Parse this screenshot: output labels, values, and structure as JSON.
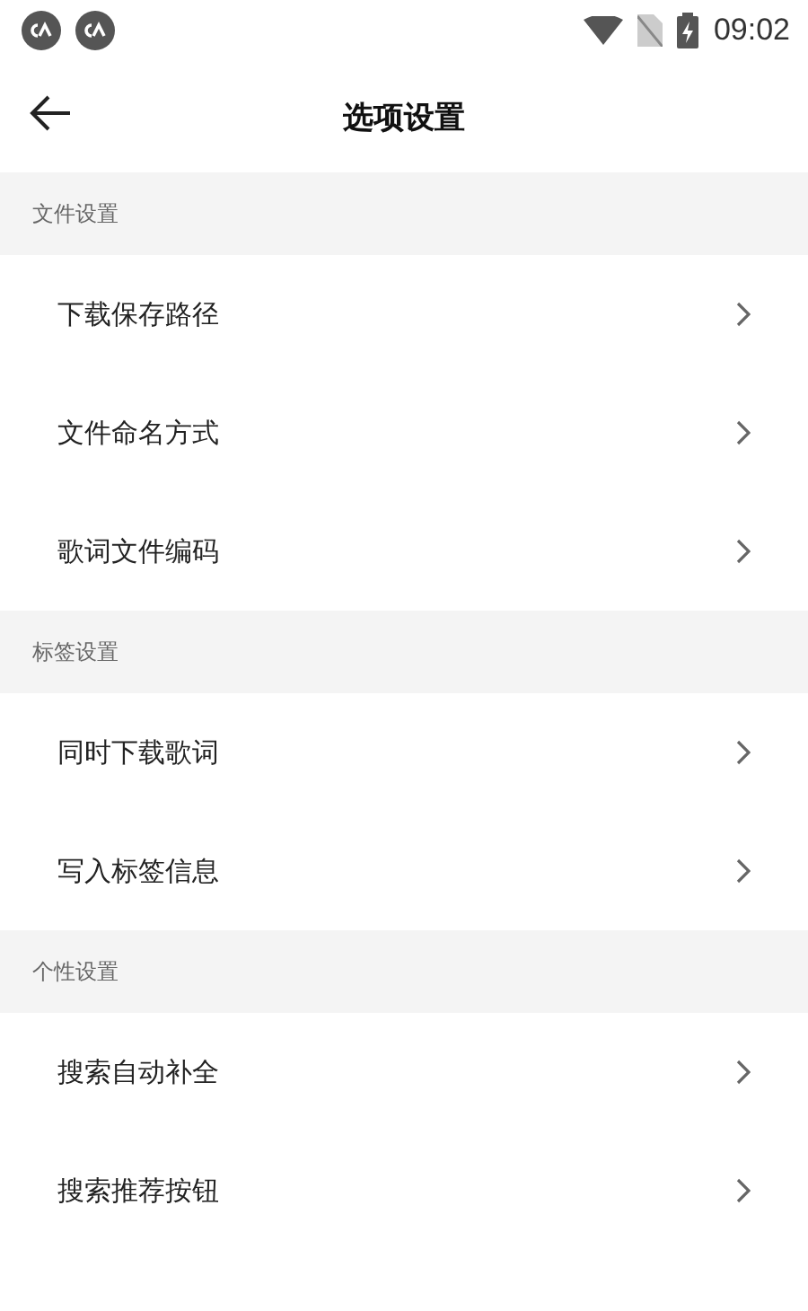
{
  "status_bar": {
    "time": "09:02"
  },
  "header": {
    "title": "选项设置"
  },
  "sections": [
    {
      "title": "文件设置",
      "items": [
        {
          "label": "下载保存路径"
        },
        {
          "label": "文件命名方式"
        },
        {
          "label": "歌词文件编码"
        }
      ]
    },
    {
      "title": "标签设置",
      "items": [
        {
          "label": "同时下载歌词"
        },
        {
          "label": "写入标签信息"
        }
      ]
    },
    {
      "title": "个性设置",
      "items": [
        {
          "label": "搜索自动补全"
        },
        {
          "label": "搜索推荐按钮"
        }
      ]
    }
  ]
}
